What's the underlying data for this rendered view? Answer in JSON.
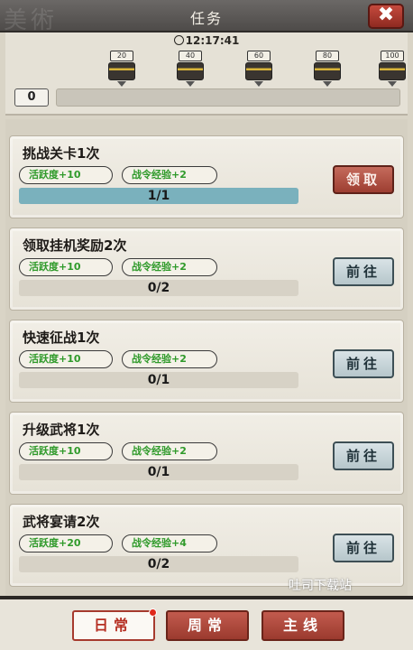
{
  "header": {
    "title": "任务",
    "close_label": "✖",
    "calligraphy": "美術"
  },
  "timer": "12:17:41",
  "milestones": [
    "20",
    "40",
    "60",
    "80",
    "100"
  ],
  "activity_total": "0",
  "activity_fill": 0,
  "tasks": [
    {
      "name": "挑战关卡1次",
      "reward1": "活跃度+10",
      "reward2": "战令经验+2",
      "progress": "1/1",
      "fill": 1.0,
      "button": "领取",
      "button_type": "claim"
    },
    {
      "name": "领取挂机奖励2次",
      "reward1": "活跃度+10",
      "reward2": "战令经验+2",
      "progress": "0/2",
      "fill": 0,
      "button": "前往",
      "button_type": "go"
    },
    {
      "name": "快速征战1次",
      "reward1": "活跃度+10",
      "reward2": "战令经验+2",
      "progress": "0/1",
      "fill": 0,
      "button": "前往",
      "button_type": "go"
    },
    {
      "name": "升级武将1次",
      "reward1": "活跃度+10",
      "reward2": "战令经验+2",
      "progress": "0/1",
      "fill": 0,
      "button": "前往",
      "button_type": "go"
    },
    {
      "name": "武将宴请2次",
      "reward1": "活跃度+20",
      "reward2": "战令经验+4",
      "progress": "0/2",
      "fill": 0,
      "button": "前往",
      "button_type": "go"
    }
  ],
  "watermark": "吐司下载站",
  "tabs": [
    {
      "label": "日常",
      "active": true
    },
    {
      "label": "周常",
      "active": false
    },
    {
      "label": "主线",
      "active": false
    }
  ],
  "colors": {
    "accent_red": "#a63a2e",
    "reward_green": "#2f9a2a",
    "progress_fill": "#7ab1bd"
  }
}
